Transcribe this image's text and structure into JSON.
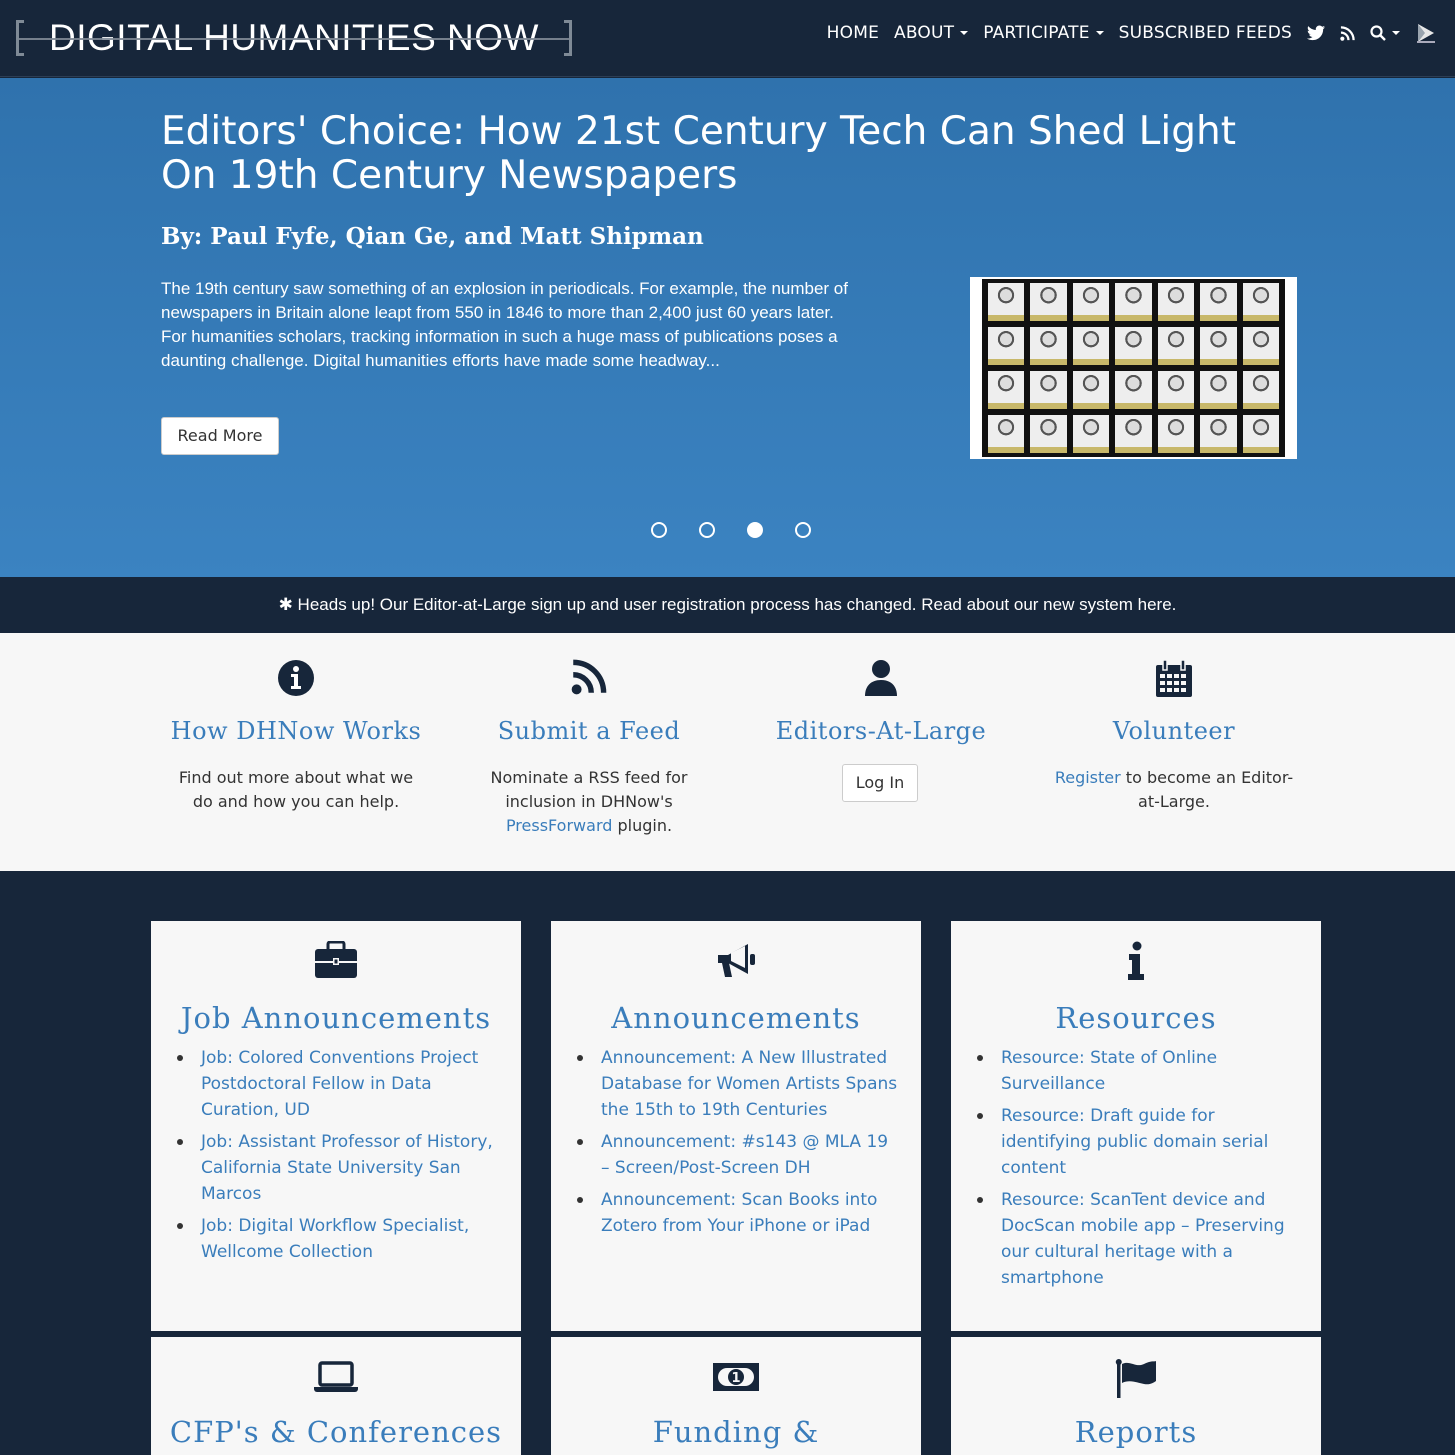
{
  "brand": {
    "title": "DIGITAL HUMANITIES NOW"
  },
  "nav": {
    "home": "HOME",
    "about": "ABOUT",
    "participate": "PARTICIPATE",
    "feeds": "SUBSCRIBED FEEDS"
  },
  "hero": {
    "title": "Editors' Choice: How 21st Century Tech Can Shed Light On 19th Century Newspapers",
    "byline": "By: Paul Fyfe, Qian Ge, and Matt Shipman",
    "excerpt": "The 19th century saw something of an explosion in periodicals. For example, the number of newspapers in Britain alone leapt from 550 in 1846 to more than 2,400 just 60 years later. For humanities scholars, tracking information in such a huge mass of publications poses a daunting challenge. Digital humanities efforts have made some headway...",
    "read_more": "Read More",
    "slide_count": 4,
    "active_slide": 3
  },
  "alert": {
    "text": "✱ Heads up! Our Editor-at-Large sign up and user registration process has changed. Read about our new system here."
  },
  "features": {
    "how": {
      "title": "How DHNow Works",
      "desc": "Find out more about what we do and how you can help."
    },
    "submit": {
      "title": "Submit a Feed",
      "desc_pre": "Nominate a RSS feed for inclusion in DHNow's ",
      "link": "PressForward",
      "desc_post": " plugin."
    },
    "editors": {
      "title": "Editors-At-Large",
      "login": "Log In"
    },
    "volunteer": {
      "title": "Volunteer",
      "link": "Register",
      "desc_post": " to become an Editor-at-Large."
    }
  },
  "cards": {
    "jobs": {
      "title": "Job Announcements",
      "items": [
        "Job: Colored Conventions Project Postdoctoral Fellow in Data Curation, UD",
        "Job: Assistant Professor of History, California State University San Marcos",
        "Job: Digital Workflow Specialist, Wellcome Collection"
      ]
    },
    "announcements": {
      "title": "Announcements",
      "items": [
        "Announcement: A New Illustrated Database for Women Artists Spans the 15th to 19th Centuries",
        "Announcement: #s143 @ MLA 19 – Screen/Post-Screen DH",
        "Announcement: Scan Books into Zotero from Your iPhone or iPad"
      ]
    },
    "resources": {
      "title": "Resources",
      "items": [
        "Resource: State of Online Surveillance",
        "Resource: Draft guide for identifying public domain serial content",
        "Resource: ScanTent device and DocScan mobile app – Preserving our cultural heritage with a smartphone"
      ]
    },
    "cfp": {
      "title": "CFP's & Conferences"
    },
    "funding": {
      "title": "Funding &"
    },
    "reports": {
      "title": "Reports"
    }
  },
  "colors": {
    "navy": "#17263a",
    "hero_blue": "#3378b5",
    "link_blue": "#3a7dbb",
    "panel": "#f7f7f7"
  },
  "icons": [
    "twitter-icon",
    "rss-icon",
    "search-icon",
    "pressforward-icon",
    "info-icon",
    "user-icon",
    "calendar-icon",
    "briefcase-icon",
    "megaphone-icon",
    "laptop-icon",
    "money-icon",
    "flag-icon"
  ]
}
